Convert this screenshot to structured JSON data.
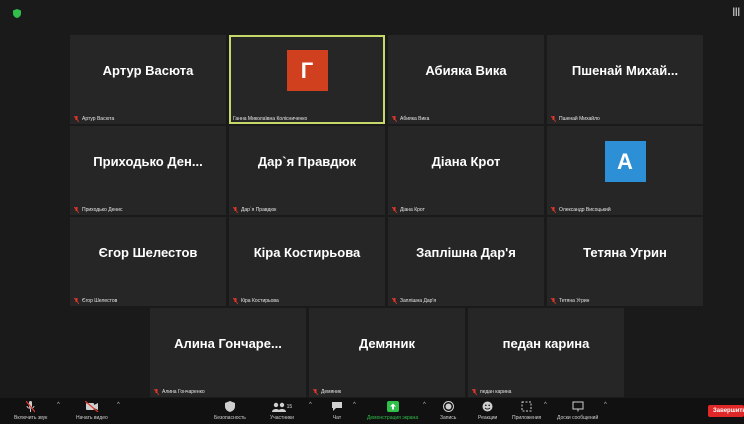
{
  "colors": {
    "background": "#1a1a1a",
    "tile": "#262626",
    "active_speaker_border": "#c5d96a",
    "avatar_orange": "#d0401e",
    "avatar_blue": "#2d8fd5",
    "mute_red": "#e0372b",
    "share_green": "#2fbf4a",
    "end_red": "#e02828"
  },
  "topbar": {
    "security_icon": "green-shield-icon",
    "view_icon": "grid-view-icon"
  },
  "participants": [
    {
      "big": "Артур Васюта",
      "small": "Артур Васюта",
      "muted": true
    },
    {
      "big": "Г",
      "small": "Ганна Миколаївна Колісниченко",
      "avatar": true,
      "avatar_color": "#d0401e",
      "active": true,
      "muted": false
    },
    {
      "big": "Абияка Вика",
      "small": "Абияка Вика",
      "muted": true
    },
    {
      "big": "Пшенай Михай...",
      "small": "Пшенай Михайло",
      "muted": true
    },
    {
      "big": "Приходько Ден...",
      "small": "Приходько Денис",
      "muted": true
    },
    {
      "big": "Дар`я Правдюк",
      "small": "Дар`я Правдюк",
      "muted": true
    },
    {
      "big": "Діана Крот",
      "small": "Діана Крот",
      "muted": true
    },
    {
      "big": "А",
      "small": "Олександр Висоцький",
      "avatar": true,
      "avatar_color": "#2d8fd5",
      "muted": true
    },
    {
      "big": "Єгор Шелестов",
      "small": "Єгор Шелестов",
      "muted": true
    },
    {
      "big": "Кіра Костирьова",
      "small": "Кіра Костирьова",
      "muted": true
    },
    {
      "big": "Заплішна Дар'я",
      "small": "Заплішна Дар'я",
      "muted": true
    },
    {
      "big": "Тетяна Угрин",
      "small": "Тетяна Угрин",
      "muted": true
    },
    {
      "big": "Алина Гончаре...",
      "small": "Алина Гончаренко",
      "muted": true
    },
    {
      "big": "Демяник",
      "small": "Демяник",
      "muted": true
    },
    {
      "big": "педан карина",
      "small": "педан карина",
      "muted": true
    }
  ],
  "toolbar": {
    "unmute": {
      "label": "Включить звук",
      "icon": "muted-mic-icon"
    },
    "start_video": {
      "label": "Начать видео",
      "icon": "video-off-icon"
    },
    "security": {
      "label": "Безопасность",
      "icon": "shield-icon"
    },
    "participants": {
      "label": "Участники",
      "icon": "participants-icon",
      "count": "15"
    },
    "chat": {
      "label": "Чат",
      "icon": "chat-icon"
    },
    "share": {
      "label": "Демонстрация экрана",
      "icon": "share-screen-icon"
    },
    "record": {
      "label": "Запись",
      "icon": "record-icon"
    },
    "reactions": {
      "label": "Реакции",
      "icon": "reactions-icon"
    },
    "apps": {
      "label": "Приложения",
      "icon": "apps-icon"
    },
    "whiteboards": {
      "label": "Доски сообщений",
      "icon": "whiteboard-icon"
    },
    "end": {
      "label": "Завершить"
    }
  }
}
